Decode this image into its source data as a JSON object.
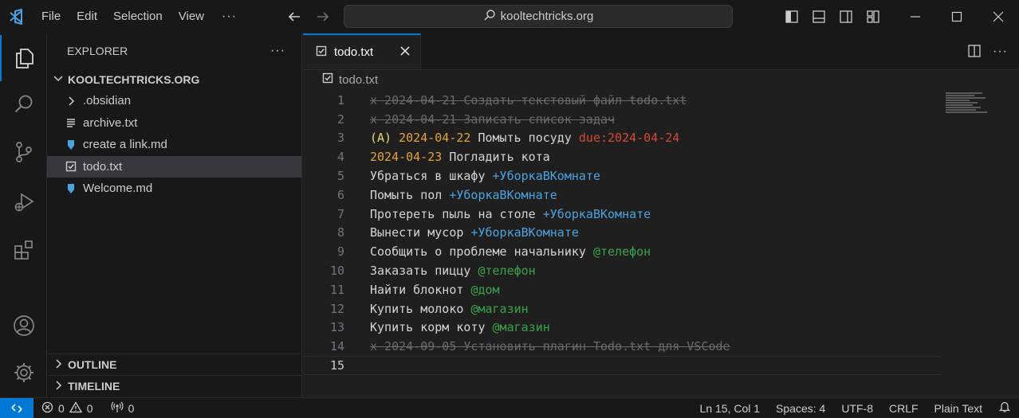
{
  "titlebar": {
    "menu": [
      "File",
      "Edit",
      "Selection",
      "View"
    ],
    "more": "···",
    "command_center": "kooltechtricks.org"
  },
  "activitybar": {
    "icons": [
      "explorer-icon",
      "search-icon",
      "source-control-icon",
      "run-debug-icon",
      "extensions-icon",
      "account-icon",
      "settings-gear-icon"
    ]
  },
  "sidebar": {
    "title": "EXPLORER",
    "more": "···",
    "folder": "KOOLTECHTRICKS.ORG",
    "items": [
      {
        "label": ".obsidian",
        "icon": "chevron-right-icon"
      },
      {
        "label": "archive.txt",
        "icon": "lines-file-icon"
      },
      {
        "label": "create a link.md",
        "icon": "markdown-file-icon"
      },
      {
        "label": "todo.txt",
        "icon": "checkbox-file-icon"
      },
      {
        "label": "Welcome.md",
        "icon": "markdown-file-icon"
      }
    ],
    "sections": [
      "OUTLINE",
      "TIMELINE"
    ]
  },
  "editor": {
    "tab_label": "todo.txt",
    "breadcrumb": "todo.txt",
    "lines": [
      {
        "n": "1",
        "parts": [
          {
            "t": "x 2024-04-21 Создать текстовый файл todo.txt",
            "c": "done"
          }
        ]
      },
      {
        "n": "2",
        "parts": [
          {
            "t": "x 2024-04-21 Записать список задач",
            "c": "done"
          }
        ]
      },
      {
        "n": "3",
        "parts": [
          {
            "t": "(A) ",
            "c": "prio"
          },
          {
            "t": "2024-04-22",
            "c": "date"
          },
          {
            "t": " Помыть посуду ",
            "c": ""
          },
          {
            "t": "due:2024-04-24",
            "c": "due"
          }
        ]
      },
      {
        "n": "4",
        "parts": [
          {
            "t": "2024-04-23",
            "c": "date"
          },
          {
            "t": " Погладить кота",
            "c": ""
          }
        ]
      },
      {
        "n": "5",
        "parts": [
          {
            "t": "Убраться в шкафу ",
            "c": ""
          },
          {
            "t": "+УборкаВКомнате",
            "c": "proj"
          }
        ]
      },
      {
        "n": "6",
        "parts": [
          {
            "t": "Помыть пол ",
            "c": ""
          },
          {
            "t": "+УборкаВКомнате",
            "c": "proj"
          }
        ]
      },
      {
        "n": "7",
        "parts": [
          {
            "t": "Протереть пыль на столе ",
            "c": ""
          },
          {
            "t": "+УборкаВКомнате",
            "c": "proj"
          }
        ]
      },
      {
        "n": "8",
        "parts": [
          {
            "t": "Вынести мусор ",
            "c": ""
          },
          {
            "t": "+УборкаВКомнате",
            "c": "proj"
          }
        ]
      },
      {
        "n": "9",
        "parts": [
          {
            "t": "Сообщить о проблеме начальнику ",
            "c": ""
          },
          {
            "t": "@телефон",
            "c": "ctx"
          }
        ]
      },
      {
        "n": "10",
        "parts": [
          {
            "t": "Заказать пиццу ",
            "c": ""
          },
          {
            "t": "@телефон",
            "c": "ctx"
          }
        ]
      },
      {
        "n": "11",
        "parts": [
          {
            "t": "Найти блокнот ",
            "c": ""
          },
          {
            "t": "@дом",
            "c": "ctx"
          }
        ]
      },
      {
        "n": "12",
        "parts": [
          {
            "t": "Купить молоко ",
            "c": ""
          },
          {
            "t": "@магазин",
            "c": "ctx"
          }
        ]
      },
      {
        "n": "13",
        "parts": [
          {
            "t": "Купить корм коту ",
            "c": ""
          },
          {
            "t": "@магазин",
            "c": "ctx"
          }
        ]
      },
      {
        "n": "14",
        "parts": [
          {
            "t": "x 2024-09-05 Установить плагин Todo.txt для VSCode",
            "c": "done"
          }
        ]
      },
      {
        "n": "15",
        "parts": [
          {
            "t": "",
            "c": ""
          }
        ]
      }
    ],
    "current_line": "15"
  },
  "statusbar": {
    "errors": "0",
    "warnings": "0",
    "ports": "0",
    "position": "Ln 15, Col 1",
    "spaces": "Spaces: 4",
    "encoding": "UTF-8",
    "eol": "CRLF",
    "language": "Plain Text"
  },
  "colors": {
    "accent": "#0078d4",
    "done": "#6a6a6a",
    "priority": "#e6db74",
    "date": "#e5a23a",
    "due": "#d34a33",
    "project": "#4aa3e0",
    "context": "#37a447"
  }
}
